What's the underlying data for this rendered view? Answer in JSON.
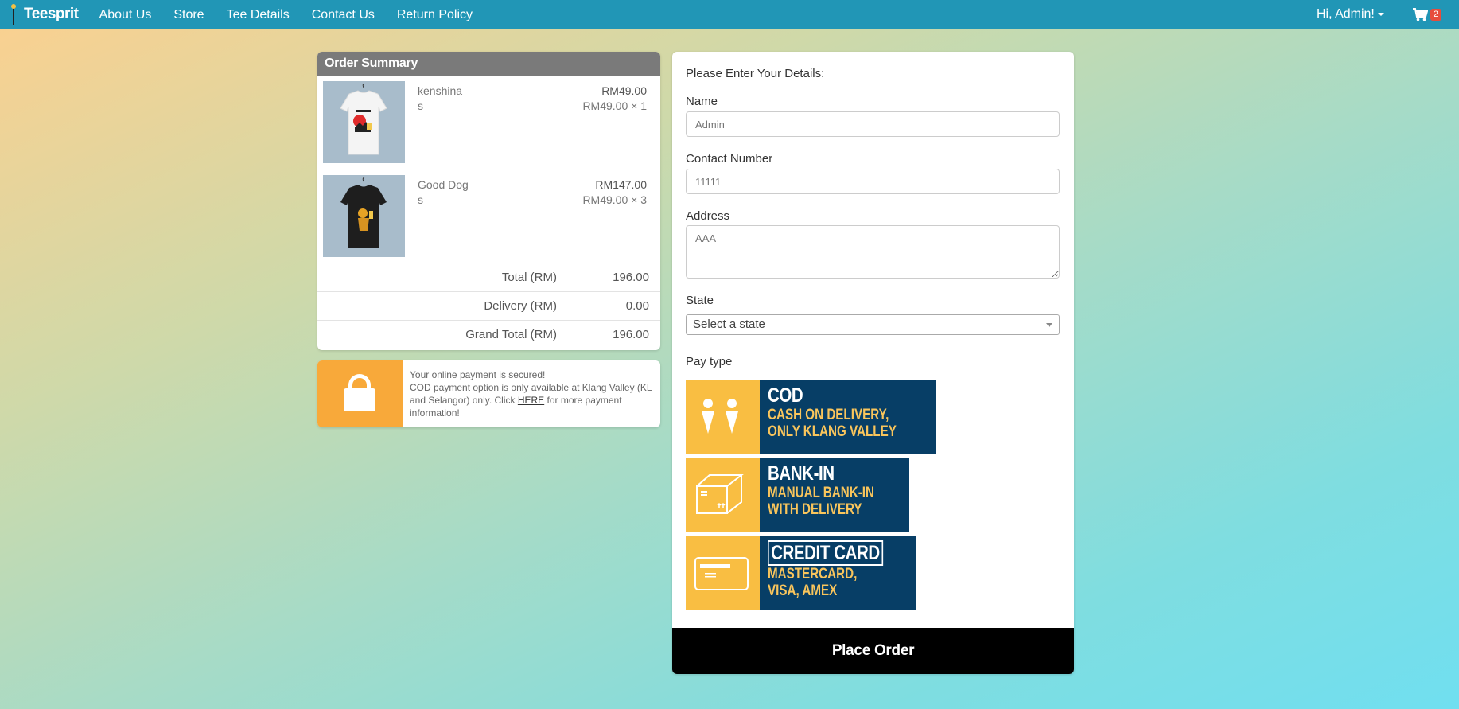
{
  "nav": {
    "brand": "Teesprit",
    "links": [
      "About Us",
      "Store",
      "Tee Details",
      "Contact Us",
      "Return Policy"
    ],
    "user_greeting": "Hi, Admin!",
    "cart_count": "2"
  },
  "summary": {
    "title": "Order Summary",
    "items": [
      {
        "name": "kenshina",
        "size": "s",
        "price": "RM49.00",
        "unit": "RM49.00 × 1",
        "shirt_color": "white"
      },
      {
        "name": "Good Dog",
        "size": "s",
        "price": "RM147.00",
        "unit": "RM49.00 × 3",
        "shirt_color": "black"
      }
    ],
    "totals": [
      {
        "label": "Total (RM)",
        "value": "196.00"
      },
      {
        "label": "Delivery (RM)",
        "value": "0.00"
      },
      {
        "label": "Grand Total (RM)",
        "value": "196.00"
      }
    ]
  },
  "secure": {
    "line1": "Your online payment is secured!",
    "line2_pre": "COD payment option is only available at Klang Valley (KL and Selangor) only. Click ",
    "link": "HERE",
    "line2_post": " for more payment information!"
  },
  "form": {
    "title": "Please Enter Your Details:",
    "name_label": "Name",
    "name_value": "Admin",
    "contact_label": "Contact Number",
    "contact_value": "11111",
    "address_label": "Address",
    "address_value": "AAA",
    "state_label": "State",
    "state_placeholder": "Select a state",
    "pay_label": "Pay type",
    "pay_options": [
      {
        "title": "COD",
        "sub1": "CASH ON DELIVERY,",
        "sub2": "ONLY KLANG VALLEY",
        "icon": "people-icon"
      },
      {
        "title": "BANK-IN",
        "sub1": "MANUAL BANK-IN",
        "sub2": "WITH DELIVERY",
        "icon": "box-icon"
      },
      {
        "title": "CREDIT CARD",
        "sub1": "MASTERCARD,",
        "sub2": "VISA, AMEX",
        "icon": "card-icon"
      }
    ],
    "submit": "Place Order"
  },
  "colors": {
    "navbar": "#2196b6",
    "pay_dark": "#073e66",
    "pay_yellow": "#f9be42",
    "lock_orange": "#f8a93a"
  }
}
